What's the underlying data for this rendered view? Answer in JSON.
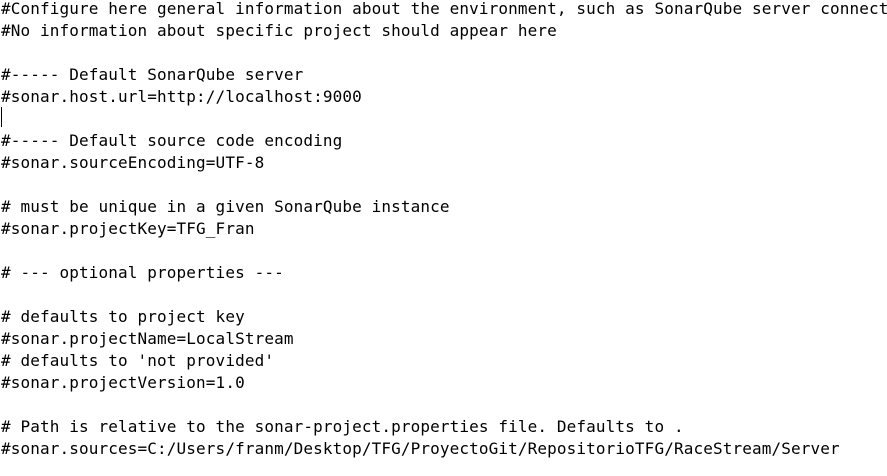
{
  "editor": {
    "lines": [
      "#Configure here general information about the environment, such as SonarQube server connection details for example",
      "#No information about specific project should appear here",
      "",
      "#----- Default SonarQube server",
      "#sonar.host.url=http://localhost:9000",
      "",
      "#----- Default source code encoding",
      "#sonar.sourceEncoding=UTF-8",
      "",
      "# must be unique in a given SonarQube instance",
      "#sonar.projectKey=TFG_Fran",
      "",
      "# --- optional properties ---",
      "",
      "# defaults to project key",
      "#sonar.projectName=LocalStream",
      "# defaults to 'not provided'",
      "#sonar.projectVersion=1.0",
      "",
      "# Path is relative to the sonar-project.properties file. Defaults to .",
      "#sonar.sources=C:/Users/franm/Desktop/TFG/ProyectoGit/RepositorioTFG/RaceStream/Server"
    ]
  }
}
